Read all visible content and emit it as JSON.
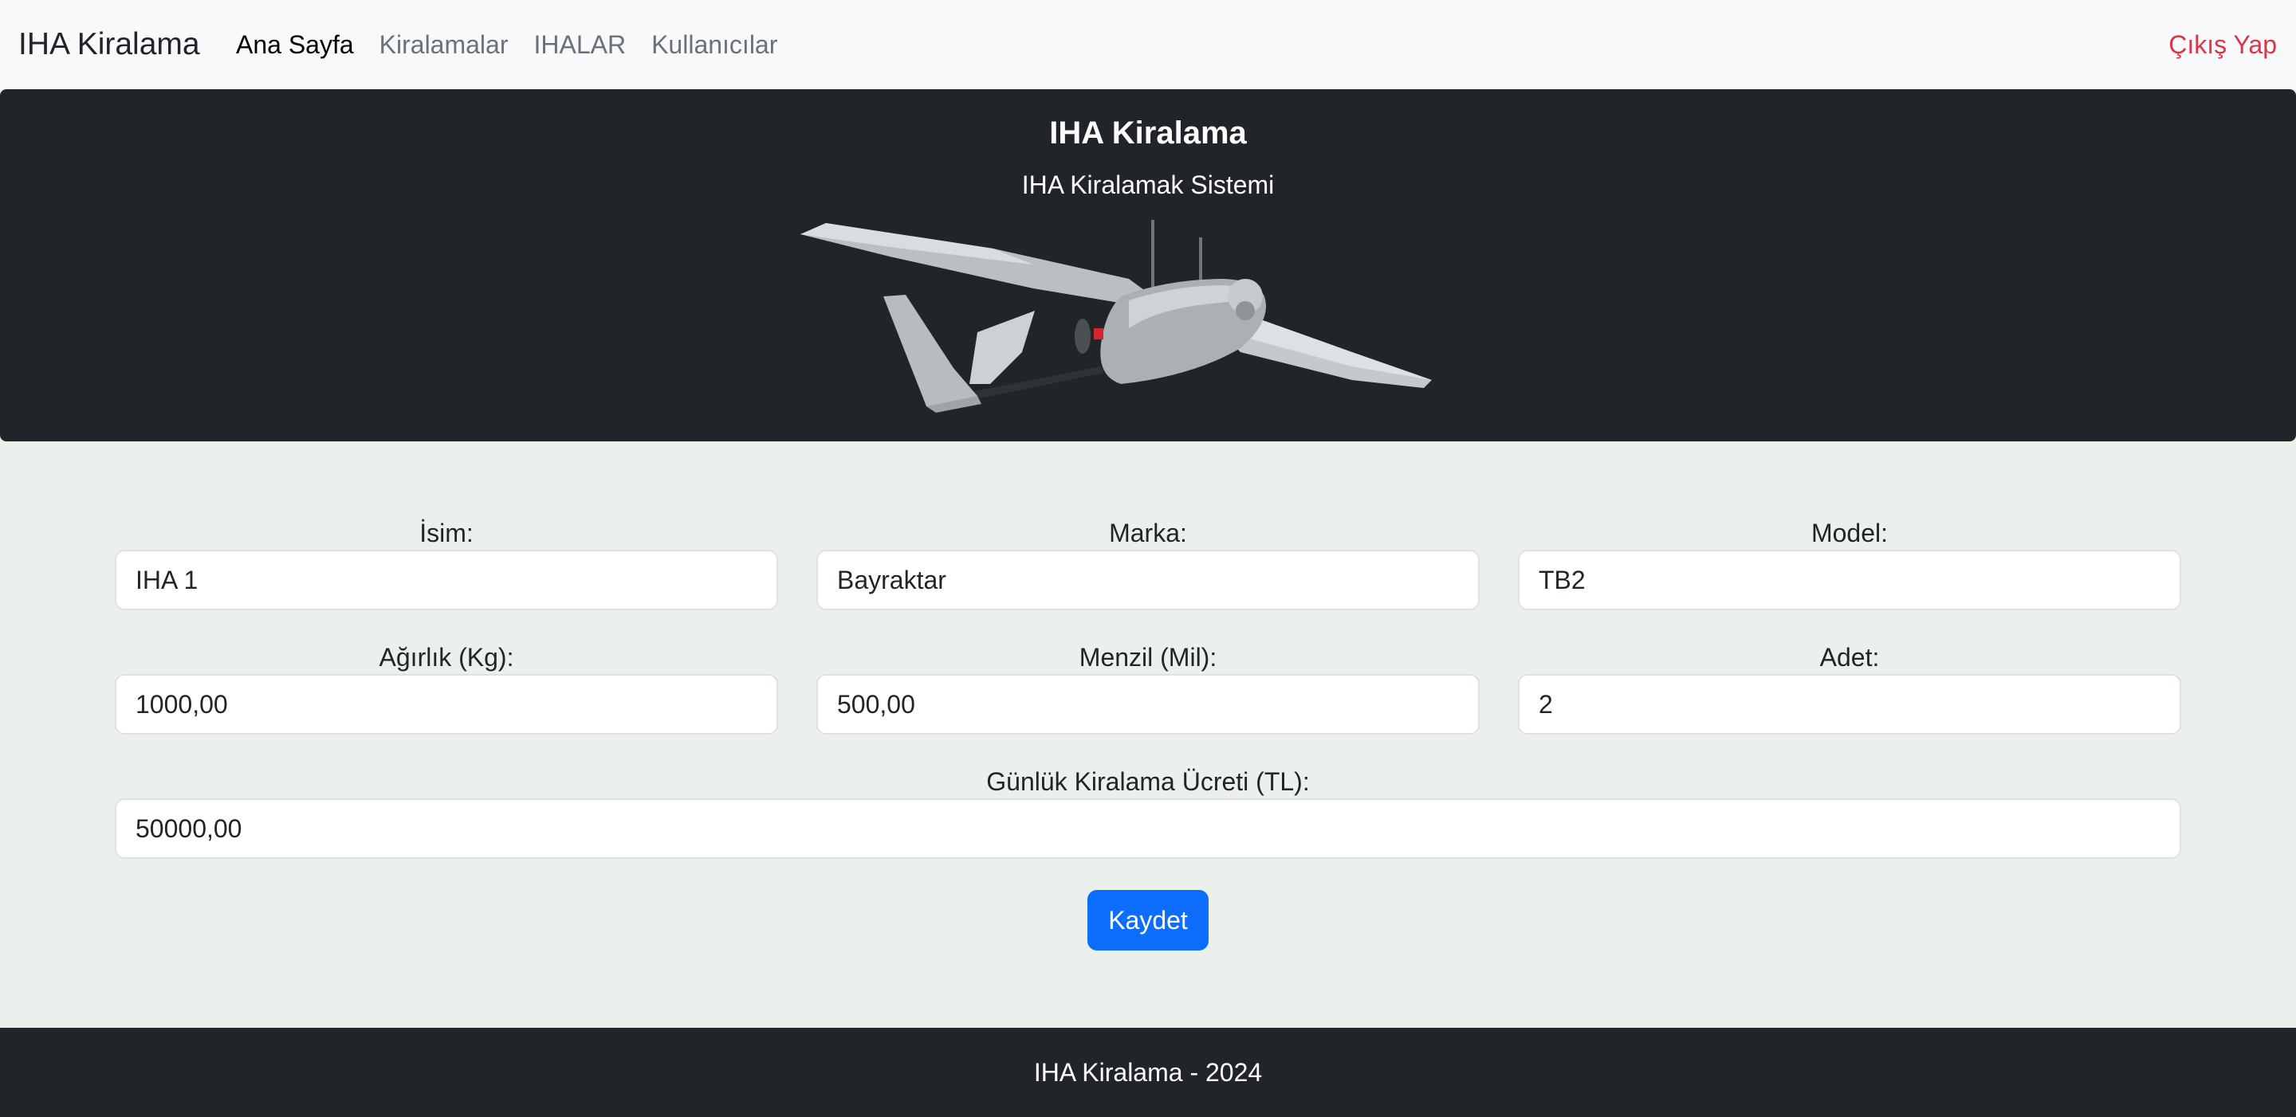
{
  "navbar": {
    "brand": "IHA Kiralama",
    "links": [
      {
        "label": "Ana Sayfa"
      },
      {
        "label": "Kiralamalar"
      },
      {
        "label": "IHALAR"
      },
      {
        "label": "Kullanıcılar"
      }
    ],
    "logout_label": "Çıkış Yap"
  },
  "hero": {
    "title": "IHA Kiralama",
    "subtitle": "IHA Kiralamak Sistemi"
  },
  "form": {
    "fields": [
      {
        "label": "İsim:",
        "value": "IHA 1"
      },
      {
        "label": "Marka:",
        "value": "Bayraktar"
      },
      {
        "label": "Model:",
        "value": "TB2"
      },
      {
        "label": "Ağırlık (Kg):",
        "value": "1000,00"
      },
      {
        "label": "Menzil (Mil):",
        "value": "500,00"
      },
      {
        "label": "Adet:",
        "value": "2"
      },
      {
        "label": "Günlük Kiralama Ücreti (TL):",
        "value": "50000,00"
      }
    ],
    "save_label": "Kaydet"
  },
  "footer": {
    "text": "IHA Kiralama - 2024"
  },
  "colors": {
    "navbar_bg": "#f8f9fa",
    "hero_bg": "#212529",
    "page_bg": "#ecf0ec",
    "primary": "#0d6efd",
    "logout": "#dc3545"
  }
}
